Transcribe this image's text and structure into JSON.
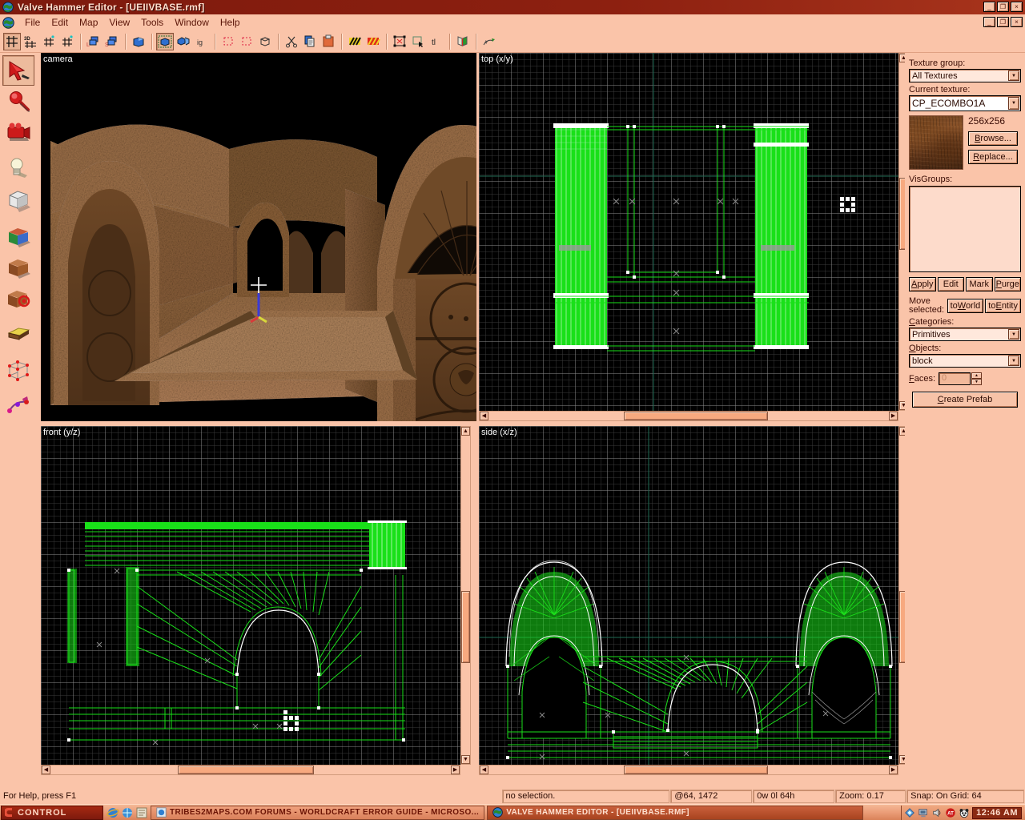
{
  "window": {
    "title": "Valve Hammer Editor - [UEIIVBASE.rmf]",
    "app_icon": "globe-icon",
    "minimize": "_",
    "maximize": "❐",
    "close": "×",
    "mdi_minimize": "_",
    "mdi_restore": "❐",
    "mdi_close": "×"
  },
  "menu": {
    "items": [
      {
        "label": "File"
      },
      {
        "label": "Edit"
      },
      {
        "label": "Map"
      },
      {
        "label": "View"
      },
      {
        "label": "Tools"
      },
      {
        "label": "Window"
      },
      {
        "label": "Help"
      }
    ]
  },
  "toolbar": {
    "buttons": [
      {
        "name": "new-map-button",
        "glyph": "⌗",
        "pressed": true
      },
      {
        "name": "toggle-3d-grid-button",
        "glyph": "3D",
        "pressed": false
      },
      {
        "name": "smaller-grid-button",
        "glyph": "⌗",
        "pressed": false
      },
      {
        "name": "larger-grid-button",
        "glyph": "⌗",
        "pressed": false
      },
      {
        "name": "sep1",
        "glyph": "|",
        "sep": true
      },
      {
        "name": "load-pointfile-button",
        "glyph": "L",
        "pressed": false
      },
      {
        "name": "save-pointfile-button",
        "glyph": "S",
        "pressed": false
      },
      {
        "name": "sep2",
        "glyph": "|",
        "sep": true
      },
      {
        "name": "carve-button",
        "glyph": "◧",
        "pressed": false
      },
      {
        "name": "sep3",
        "glyph": "|",
        "sep": true
      },
      {
        "name": "group-button",
        "glyph": "▣",
        "pressed": true
      },
      {
        "name": "ungroup-button",
        "glyph": "▢",
        "pressed": false
      },
      {
        "name": "ignore-groups-button",
        "glyph": "ig",
        "pressed": false
      },
      {
        "name": "sep4",
        "glyph": "|",
        "sep": true
      },
      {
        "name": "hide-selected-button",
        "glyph": "⬚",
        "pressed": false
      },
      {
        "name": "hide-unselected-button",
        "glyph": "⬚",
        "pressed": false
      },
      {
        "name": "show-all-button",
        "glyph": "⬜",
        "pressed": false
      },
      {
        "name": "sep5",
        "glyph": "|",
        "sep": true
      },
      {
        "name": "cut-button",
        "glyph": "✂",
        "pressed": false
      },
      {
        "name": "copy-button",
        "glyph": "❐",
        "pressed": false
      },
      {
        "name": "paste-button",
        "glyph": "Ὄb",
        "pressed": false
      },
      {
        "name": "sep6",
        "glyph": "|",
        "sep": true
      },
      {
        "name": "toggle-selection-button",
        "glyph": "╱",
        "pressed": false
      },
      {
        "name": "toggle-cordon-button",
        "glyph": "╳",
        "pressed": false
      },
      {
        "name": "sep7",
        "glyph": "|",
        "sep": true
      },
      {
        "name": "cordon-tool-button",
        "glyph": "⧉",
        "pressed": false
      },
      {
        "name": "select-tool-button",
        "glyph": "⬚",
        "pressed": false
      },
      {
        "name": "texture-lock-button",
        "glyph": "tl",
        "pressed": false
      },
      {
        "name": "sep8",
        "glyph": "|",
        "sep": true
      },
      {
        "name": "texture-application-button",
        "glyph": "◨",
        "pressed": false
      },
      {
        "name": "sep9",
        "glyph": "|",
        "sep": true
      },
      {
        "name": "run-map-button",
        "glyph": "⤳",
        "pressed": false
      }
    ]
  },
  "tool_palette": {
    "tools": [
      {
        "name": "tool-selection",
        "label": "Selection Tool",
        "selected": true
      },
      {
        "name": "tool-magnify",
        "label": "Magnify",
        "selected": false
      },
      {
        "name": "tool-camera",
        "label": "Camera",
        "selected": false
      },
      {
        "name": "tool-entity",
        "label": "Entity Tool",
        "selected": false
      },
      {
        "name": "tool-block",
        "label": "Block Tool",
        "selected": false
      },
      {
        "name": "tool-texture-application",
        "label": "Texture Application",
        "selected": false
      },
      {
        "name": "tool-apply-decals",
        "label": "Apply Decals",
        "selected": false
      },
      {
        "name": "tool-apply-current-texture",
        "label": "Apply Current Texture",
        "selected": false
      },
      {
        "name": "tool-clipping",
        "label": "Clipping Tool",
        "selected": false
      },
      {
        "name": "tool-vertex-manipulation",
        "label": "Vertex Manipulation",
        "selected": false
      },
      {
        "name": "tool-path",
        "label": "Path Tool",
        "selected": false
      }
    ]
  },
  "viewports": [
    {
      "name": "viewport-camera",
      "label": "camera"
    },
    {
      "name": "viewport-top",
      "label": "top (x/y)"
    },
    {
      "name": "viewport-front",
      "label": "front (y/z)"
    },
    {
      "name": "viewport-side",
      "label": "side (x/z)"
    }
  ],
  "right_panel": {
    "texture_group_label": "Texture group:",
    "texture_group_value": "All Textures",
    "current_texture_label": "Current texture:",
    "current_texture_value": "CP_ECOMBO1A",
    "texture_size": "256x256",
    "browse_label": "Browse...",
    "replace_label": "Replace...",
    "visgroups_label": "VisGroups:",
    "visgroups_items": [],
    "apply_label": "Apply",
    "edit_label": "Edit",
    "mark_label": "Mark",
    "purge_label": "Purge",
    "move_selected_line1": "Move",
    "move_selected_line2": "selected:",
    "to_world_label": "toWorld",
    "to_entity_label": "toEntity",
    "categories_label": "Categories:",
    "categories_value": "Primitives",
    "objects_label": "Objects:",
    "objects_value": "block",
    "faces_label": "Faces:",
    "faces_value": "0",
    "create_prefab_label": "Create Prefab",
    "dropdown_arrow": "▼"
  },
  "status_bar": {
    "help_text": "For Help, press F1",
    "selection": "no selection.",
    "coordinates": "@64, 1472",
    "dimensions": "0w 0l 64h",
    "zoom": "Zoom: 0.17",
    "snap": "Snap: On Grid: 64"
  },
  "taskbar": {
    "start_label": "CONTROL",
    "quick_launch": [
      {
        "name": "ie-quicklaunch-icon"
      },
      {
        "name": "internet-quicklaunch-icon"
      },
      {
        "name": "media-quicklaunch-icon"
      }
    ],
    "items": [
      {
        "name": "taskitem-browser",
        "icon": "ie-icon",
        "label": "TRIBES2MAPS.COM FORUMS - WORLDCRAFT ERROR GUIDE - MICROSO...",
        "active": false
      },
      {
        "name": "taskitem-hammer",
        "icon": "globe-icon",
        "label": "VALVE HAMMER EDITOR - [UEIIVBASE.RMF]",
        "active": true
      }
    ],
    "tray": [
      {
        "name": "tray-network-icon"
      },
      {
        "name": "tray-display-icon"
      },
      {
        "name": "tray-volume-icon"
      },
      {
        "name": "tray-ati-icon"
      },
      {
        "name": "tray-panda-icon"
      }
    ],
    "clock": "12:46 AM"
  },
  "colors": {
    "titlebar": "#7d1a0d",
    "chrome": "#fac4a9",
    "viewport_bg": "#000000",
    "grid": "#585858",
    "geometry": "#00ee00",
    "selection": "#ffffff",
    "axis": "#2a7a5a"
  }
}
